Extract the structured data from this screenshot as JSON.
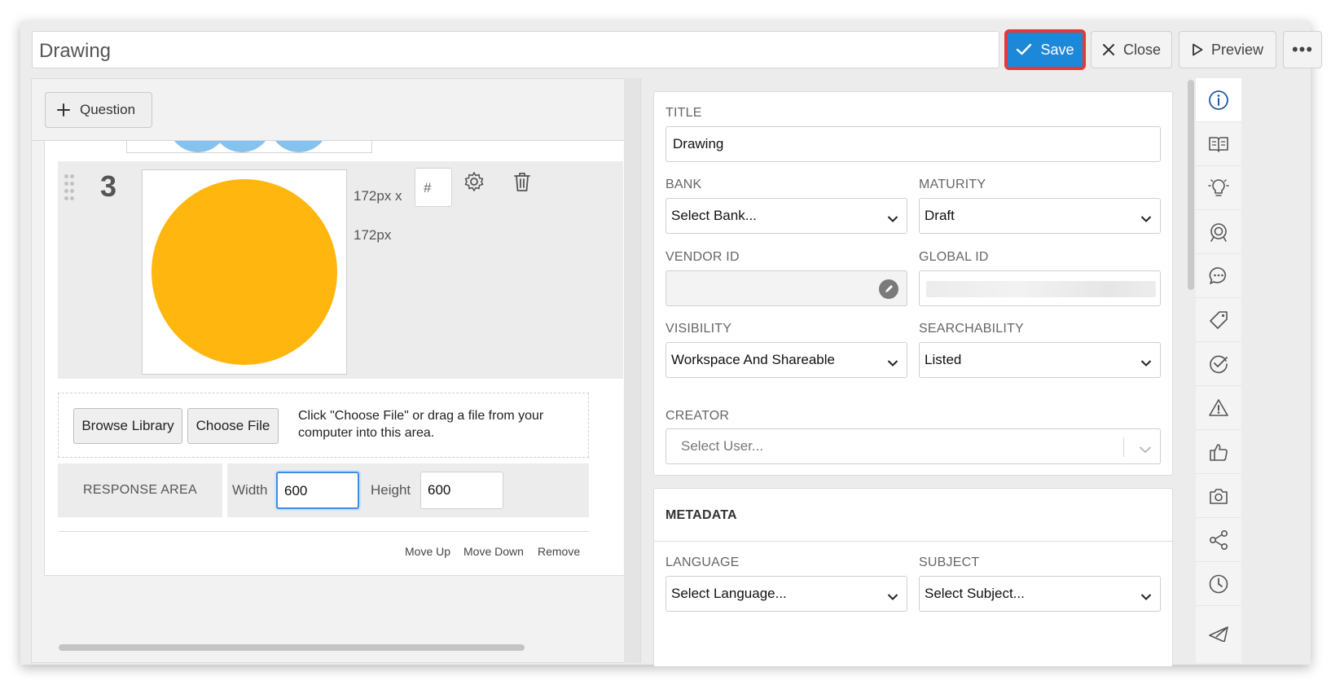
{
  "header": {
    "title_value": "Drawing",
    "save_label": "Save",
    "close_label": "Close",
    "preview_label": "Preview",
    "more_label": "•••"
  },
  "editor": {
    "add_question_label": "Question",
    "item": {
      "number": "3",
      "size_line1": "172px x",
      "size_line2": "172px",
      "hash_placeholder": "#"
    },
    "upload": {
      "browse_label": "Browse Library",
      "choose_label": "Choose File",
      "hint": "Click \"Choose File\" or drag a file from your computer into this area."
    },
    "response_area": {
      "label": "RESPONSE AREA",
      "width_label": "Width",
      "width_value": "600",
      "height_label": "Height",
      "height_value": "600"
    },
    "actions": {
      "move_up": "Move Up",
      "move_down": "Move Down",
      "remove": "Remove"
    }
  },
  "properties": {
    "title_label": "TITLE",
    "title_value": "Drawing",
    "bank_label": "BANK",
    "bank_value": "Select Bank...",
    "maturity_label": "MATURITY",
    "maturity_value": "Draft",
    "vendor_id_label": "VENDOR ID",
    "global_id_label": "GLOBAL ID",
    "visibility_label": "VISIBILITY",
    "visibility_value": "Workspace And Shareable",
    "searchability_label": "SEARCHABILITY",
    "searchability_value": "Listed",
    "creator_label": "CREATOR",
    "creator_placeholder": "Select User...",
    "metadata_title": "METADATA",
    "language_label": "LANGUAGE",
    "language_value": "Select Language...",
    "subject_label": "SUBJECT",
    "subject_value": "Select Subject..."
  },
  "rail_icons": [
    "info-icon",
    "book-icon",
    "lightbulb-icon",
    "target-icon",
    "comment-icon",
    "tag-icon",
    "check-circle-icon",
    "warning-icon",
    "thumbs-up-icon",
    "camera-icon",
    "share-icon",
    "clock-icon",
    "send-icon"
  ],
  "colors": {
    "primary": "#1e88d8",
    "highlight_outline": "#e53935",
    "sun_fill": "#ffb60f",
    "preview_dots": "#86c2ee",
    "active_icon": "#1f5aa8"
  }
}
